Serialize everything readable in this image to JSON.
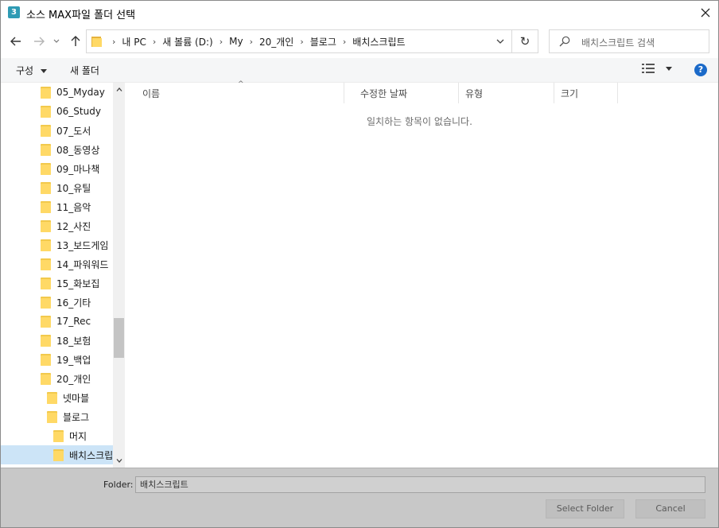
{
  "window": {
    "title": "소스 MAX파일 폴더 선택",
    "app_icon_text": "3"
  },
  "nav": {
    "breadcrumb": [
      "내 PC",
      "새 볼륨 (D:)",
      "My",
      "20_개인",
      "블로그",
      "배치스크립트"
    ],
    "search_placeholder": "배치스크립트 검색"
  },
  "toolbar": {
    "organize_label": "구성",
    "new_folder_label": "새 폴더"
  },
  "tree": {
    "items": [
      {
        "label": "05_Myday",
        "indent": 0
      },
      {
        "label": "06_Study",
        "indent": 0
      },
      {
        "label": "07_도서",
        "indent": 0
      },
      {
        "label": "08_동영상",
        "indent": 0
      },
      {
        "label": "09_마나책",
        "indent": 0
      },
      {
        "label": "10_유틸",
        "indent": 0
      },
      {
        "label": "11_음악",
        "indent": 0
      },
      {
        "label": "12_사진",
        "indent": 0
      },
      {
        "label": "13_보드게임",
        "indent": 0
      },
      {
        "label": "14_파워워드",
        "indent": 0
      },
      {
        "label": "15_화보집",
        "indent": 0
      },
      {
        "label": "16_기타",
        "indent": 0
      },
      {
        "label": "17_Rec",
        "indent": 0
      },
      {
        "label": "18_보험",
        "indent": 0
      },
      {
        "label": "19_백업",
        "indent": 0
      },
      {
        "label": "20_개인",
        "indent": 0
      },
      {
        "label": "넷마블",
        "indent": 1
      },
      {
        "label": "블로그",
        "indent": 1
      },
      {
        "label": "머지",
        "indent": 2
      },
      {
        "label": "배치스크립트",
        "indent": 2,
        "selected": true
      }
    ]
  },
  "columns": {
    "name": "이름",
    "modified": "수정한 날짜",
    "type": "유형",
    "size": "크기"
  },
  "content": {
    "empty_message": "일치하는 항목이 없습니다."
  },
  "footer": {
    "folder_label": "Folder:",
    "folder_value": "배치스크립트",
    "select_button": "Select Folder",
    "cancel_button": "Cancel"
  },
  "colors": {
    "accent": "#1b6ac9",
    "folder": "#ffd966",
    "footer_bg": "#c8c8c8",
    "selection": "#cce4f7"
  }
}
